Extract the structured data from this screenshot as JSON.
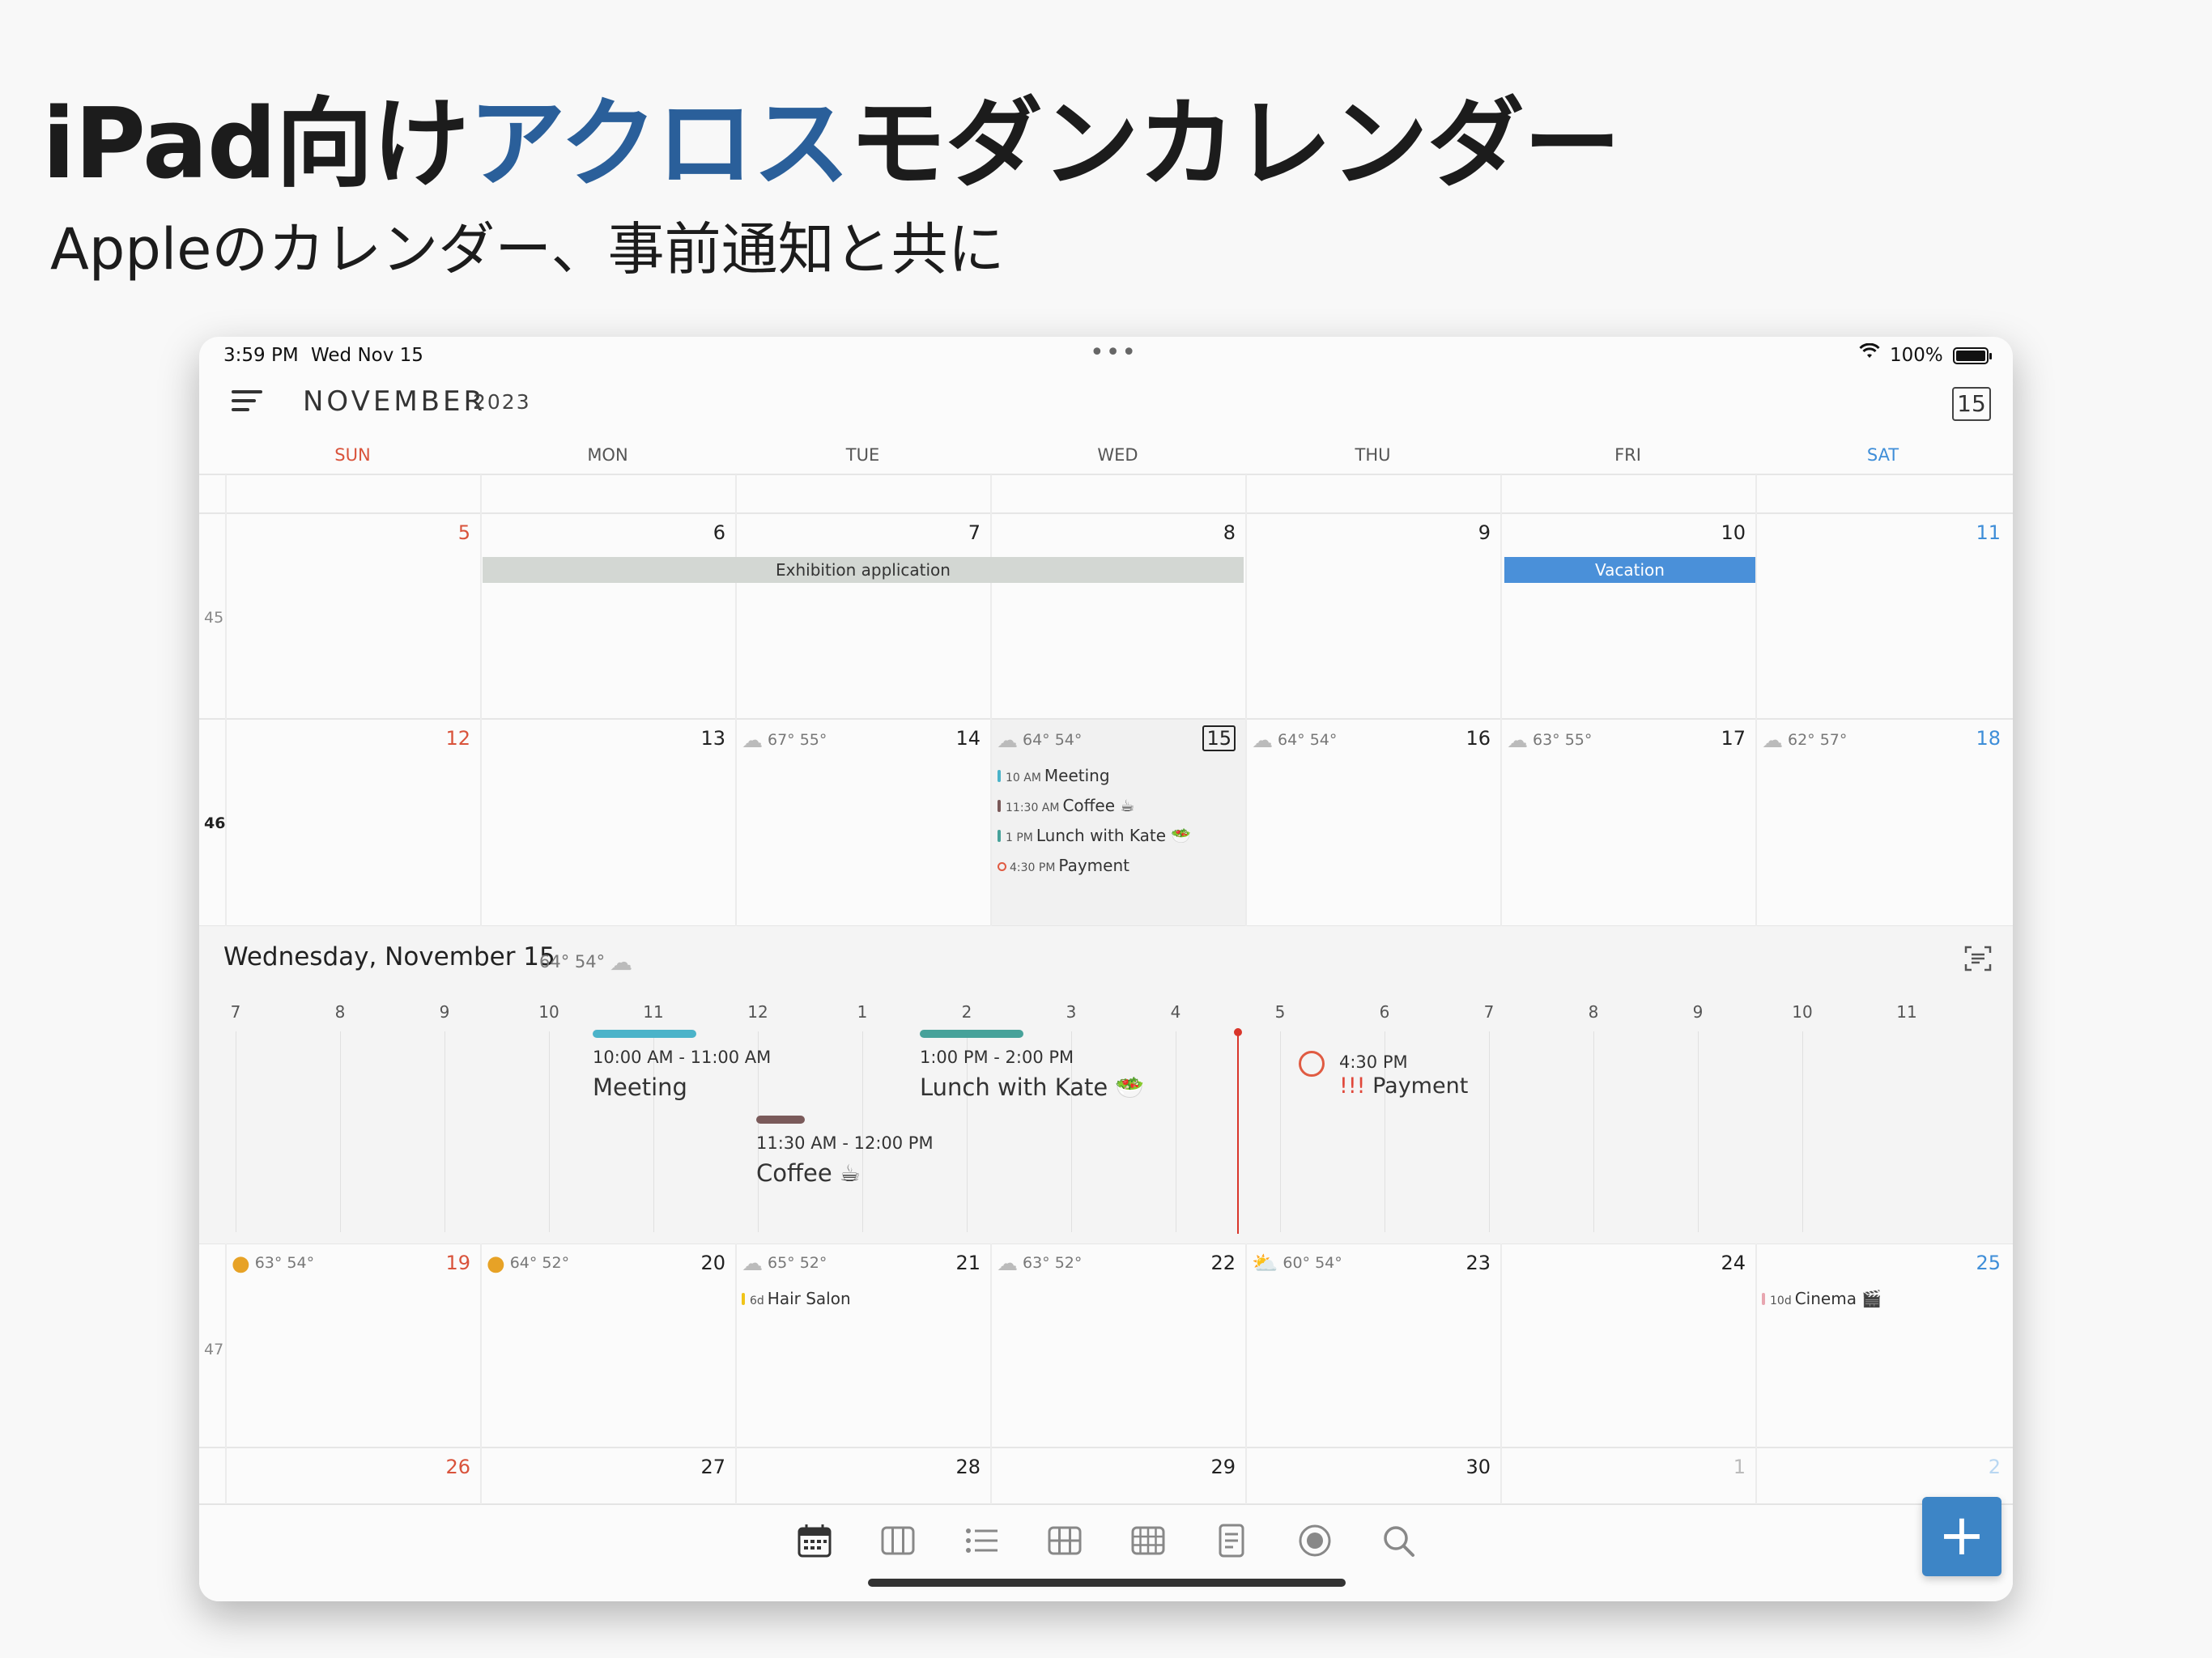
{
  "promo": {
    "title_part1": "iPad向け",
    "title_accent": "アクロス",
    "title_part2": "モダンカレンダー",
    "subtitle": "Appleのカレンダー、事前通知と共に"
  },
  "status_bar": {
    "time": "3:59 PM",
    "date": "Wed Nov 15",
    "battery": "100%",
    "battery_level": 1.0
  },
  "nav": {
    "month": "NOVEMBER",
    "year": "2023",
    "today_button": "15"
  },
  "weekdays": [
    "SUN",
    "MON",
    "TUE",
    "WED",
    "THU",
    "FRI",
    "SAT"
  ],
  "weeks": [
    {
      "week_number": "45",
      "days": [
        "5",
        "6",
        "7",
        "8",
        "9",
        "10",
        "11"
      ]
    },
    {
      "week_number": "46",
      "days": [
        "12",
        "13",
        "14",
        "15",
        "16",
        "17",
        "18"
      ]
    },
    {
      "week_number": "47",
      "days": [
        "19",
        "20",
        "21",
        "22",
        "23",
        "24",
        "25"
      ]
    },
    {
      "week_number": "",
      "days": [
        "26",
        "27",
        "28",
        "29",
        "30",
        "1",
        "2"
      ]
    }
  ],
  "all_day_events": [
    {
      "title": "Exhibition application",
      "color": "#d3d7d3"
    },
    {
      "title": "Vacation",
      "color": "#4a90d9"
    }
  ],
  "week46_weather": [
    {
      "day": "13",
      "text": "67° 55°"
    },
    {
      "day": "14",
      "text": "64° 54°"
    },
    {
      "day": "15",
      "text": "64° 54°"
    },
    {
      "day": "16",
      "text": "63° 55°"
    },
    {
      "day": "17",
      "text": "62° 57°"
    }
  ],
  "nov15_events": [
    {
      "time": "10 AM",
      "title": "Meeting",
      "color": "#4bb3c9"
    },
    {
      "time": "11:30 AM",
      "title": "Coffee ☕",
      "color": "#7a5a5a"
    },
    {
      "time": "1 PM",
      "title": "Lunch with Kate 🥗",
      "color": "#47a29a"
    },
    {
      "time": "4:30 PM",
      "title": "Payment",
      "color": "#e05b42"
    }
  ],
  "week47_weather": [
    {
      "day": "19",
      "text": "63° 54°"
    },
    {
      "day": "20",
      "text": "64° 52°"
    },
    {
      "day": "21",
      "text": "65° 52°"
    },
    {
      "day": "22",
      "text": "63° 52°"
    },
    {
      "day": "23",
      "text": "60° 54°"
    }
  ],
  "week47_events": [
    {
      "duration": "6d",
      "title": "Hair Salon",
      "color": "#f0c419"
    },
    {
      "duration": "10d",
      "title": "Cinema 🎬",
      "color": "#e8a6b0"
    }
  ],
  "day_view": {
    "title": "Wednesday, November 15",
    "weather": "64° 54°",
    "hours": [
      "7",
      "8",
      "9",
      "10",
      "11",
      "12",
      "1",
      "2",
      "3",
      "4",
      "5",
      "6",
      "7",
      "8",
      "9",
      "10",
      "11"
    ],
    "events": [
      {
        "time": "10:00 AM - 11:00 AM",
        "title": "Meeting",
        "color": "#4bb3c9"
      },
      {
        "time": "11:30 AM - 12:00 PM",
        "title": "Coffee ☕",
        "color": "#7a5a5a"
      },
      {
        "time": "1:00 PM - 2:00 PM",
        "title": "Lunch with Kate 🥗",
        "color": "#47a29a"
      },
      {
        "time": "4:30 PM",
        "priority": "!!!",
        "title": "Payment",
        "color": "#e05b42"
      }
    ]
  },
  "tab_icons": [
    "calendar-month-icon",
    "calendar-week-icon",
    "list-icon",
    "grid-small-icon",
    "grid-large-icon",
    "note-icon",
    "record-icon",
    "search-icon"
  ],
  "add_button": "+"
}
